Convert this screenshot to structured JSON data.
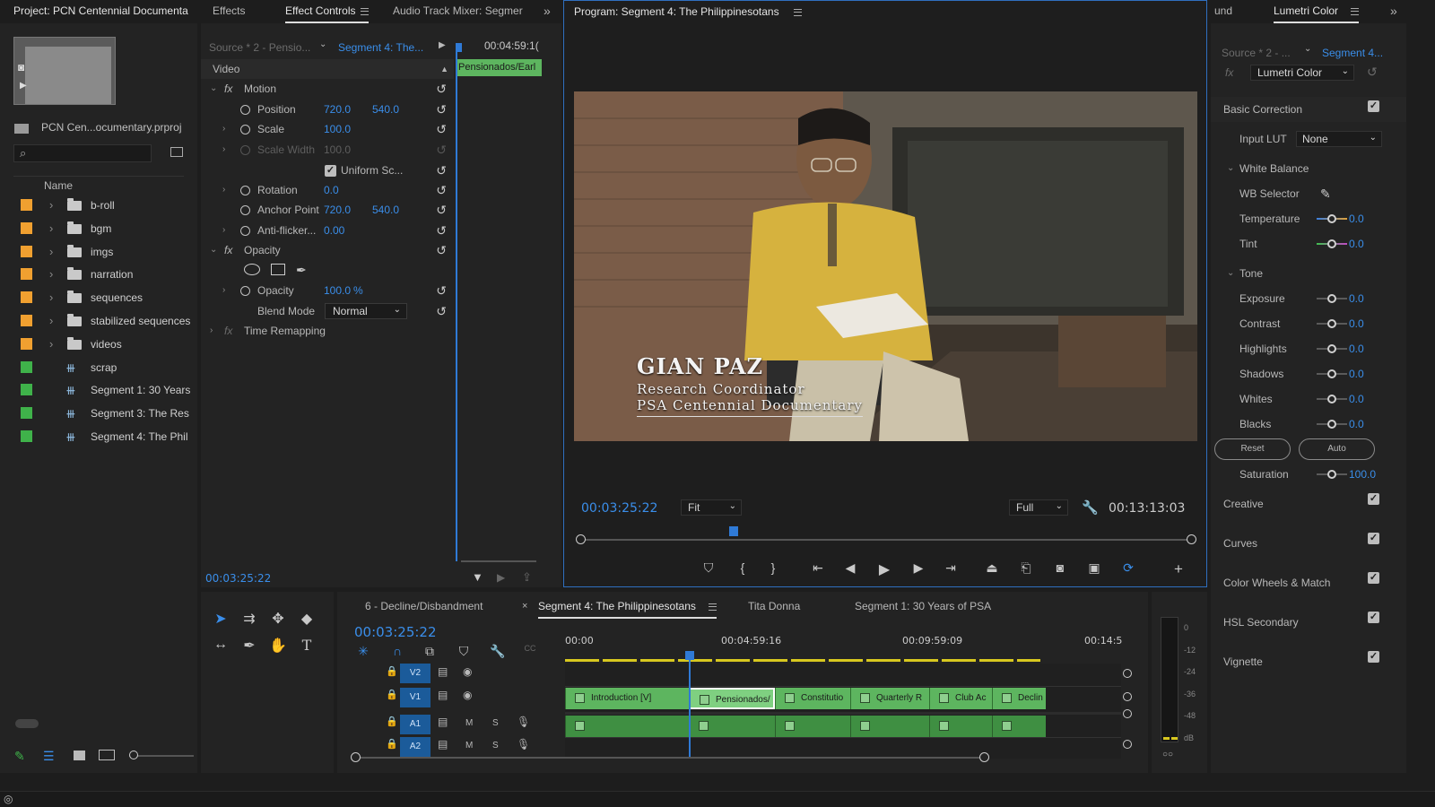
{
  "project": {
    "tab_title": "Project: PCN Centennial Documenta",
    "file_name": "PCN Cen...ocumentary.prproj",
    "column_name": "Name",
    "items": [
      {
        "label": "b-roll",
        "type": "folder",
        "color": "#f0a030"
      },
      {
        "label": "bgm",
        "type": "folder",
        "color": "#f0a030"
      },
      {
        "label": "imgs",
        "type": "folder",
        "color": "#f0a030"
      },
      {
        "label": "narration",
        "type": "folder",
        "color": "#f0a030"
      },
      {
        "label": "sequences",
        "type": "folder",
        "color": "#f0a030"
      },
      {
        "label": "stabilized sequences",
        "type": "folder",
        "color": "#f0a030"
      },
      {
        "label": "videos",
        "type": "folder",
        "color": "#f0a030"
      },
      {
        "label": "scrap",
        "type": "sequence",
        "color": "#3fb24a"
      },
      {
        "label": "Segment 1: 30 Years",
        "type": "sequence",
        "color": "#3fb24a"
      },
      {
        "label": "Segment 3: The Res",
        "type": "sequence",
        "color": "#3fb24a"
      },
      {
        "label": "Segment 4: The Phil",
        "type": "sequence",
        "color": "#3fb24a"
      }
    ]
  },
  "effect_controls": {
    "tabs": [
      "Effects",
      "Effect Controls",
      "Audio Track Mixer: Segmer"
    ],
    "source": "Source * 2 - Pensio...",
    "sequence": "Segment 4: The...",
    "timecode_top": "00:04:59:1(",
    "clip_label": "Pensionados/Earl",
    "section_video": "Video",
    "motion": "Motion",
    "position_label": "Position",
    "position_x": "720.0",
    "position_y": "540.0",
    "scale_label": "Scale",
    "scale_value": "100.0",
    "scale_width_label": "Scale Width",
    "scale_width_value": "100.0",
    "uniform_scale": "Uniform Sc...",
    "rotation_label": "Rotation",
    "rotation_value": "0.0",
    "anchor_label": "Anchor Point",
    "anchor_x": "720.0",
    "anchor_y": "540.0",
    "antiflicker_label": "Anti-flicker...",
    "antiflicker_value": "0.00",
    "opacity_section": "Opacity",
    "opacity_label": "Opacity",
    "opacity_value": "100.0",
    "opacity_unit": "%",
    "blend_label": "Blend Mode",
    "blend_value": "Normal",
    "time_remapping": "Time Remapping",
    "timecode_bottom": "00:03:25:22"
  },
  "program": {
    "title": "Program: Segment 4: The Philippinesotans",
    "lower_third_name": "GIAN PAZ",
    "lower_third_line1": "Research Coordinator",
    "lower_third_line2": "PSA Centennial Documentary",
    "timecode": "00:03:25:22",
    "fit": "Fit",
    "quality": "Full",
    "duration": "00:13:13:03",
    "playhead_fraction": 0.25
  },
  "lumetri": {
    "tab_prev": "und",
    "tab_title": "Lumetri Color",
    "source": "Source * 2 - ...",
    "sequence": "Segment 4...",
    "effect": "Lumetri Color",
    "basic_correction": "Basic Correction",
    "input_lut_label": "Input LUT",
    "input_lut_value": "None",
    "white_balance": "White Balance",
    "wb_selector": "WB Selector",
    "temperature_label": "Temperature",
    "temperature_value": "0.0",
    "tint_label": "Tint",
    "tint_value": "0.0",
    "tone": "Tone",
    "exposure_label": "Exposure",
    "exposure_value": "0.0",
    "contrast_label": "Contrast",
    "contrast_value": "0.0",
    "highlights_label": "Highlights",
    "highlights_value": "0.0",
    "shadows_label": "Shadows",
    "shadows_value": "0.0",
    "whites_label": "Whites",
    "whites_value": "0.0",
    "blacks_label": "Blacks",
    "blacks_value": "0.0",
    "reset_label": "Reset",
    "auto_label": "Auto",
    "saturation_label": "Saturation",
    "saturation_value": "100.0",
    "sections": [
      "Creative",
      "Curves",
      "Color Wheels & Match",
      "HSL Secondary",
      "Vignette"
    ]
  },
  "timeline": {
    "tabs": [
      "6 - Decline/Disbandment",
      "Segment 4: The Philippinesotans",
      "Tita Donna",
      "Segment 1: 30 Years of PSA"
    ],
    "timecode": "00:03:25:22",
    "ruler": [
      "00:00",
      "00:04:59:16",
      "00:09:59:09",
      "00:14:5"
    ],
    "tracks": {
      "v2": "V2",
      "v1": "V1",
      "a1": "A1",
      "a2": "A2",
      "mute": "M",
      "solo": "S"
    },
    "clips": [
      "Introduction [V]",
      "Pensionados/",
      "Constitutio",
      "Quarterly R",
      "Club Ac",
      "Declin"
    ],
    "meter_labels": [
      "0",
      "-12",
      "-24",
      "-36",
      "-48",
      "dB"
    ]
  }
}
